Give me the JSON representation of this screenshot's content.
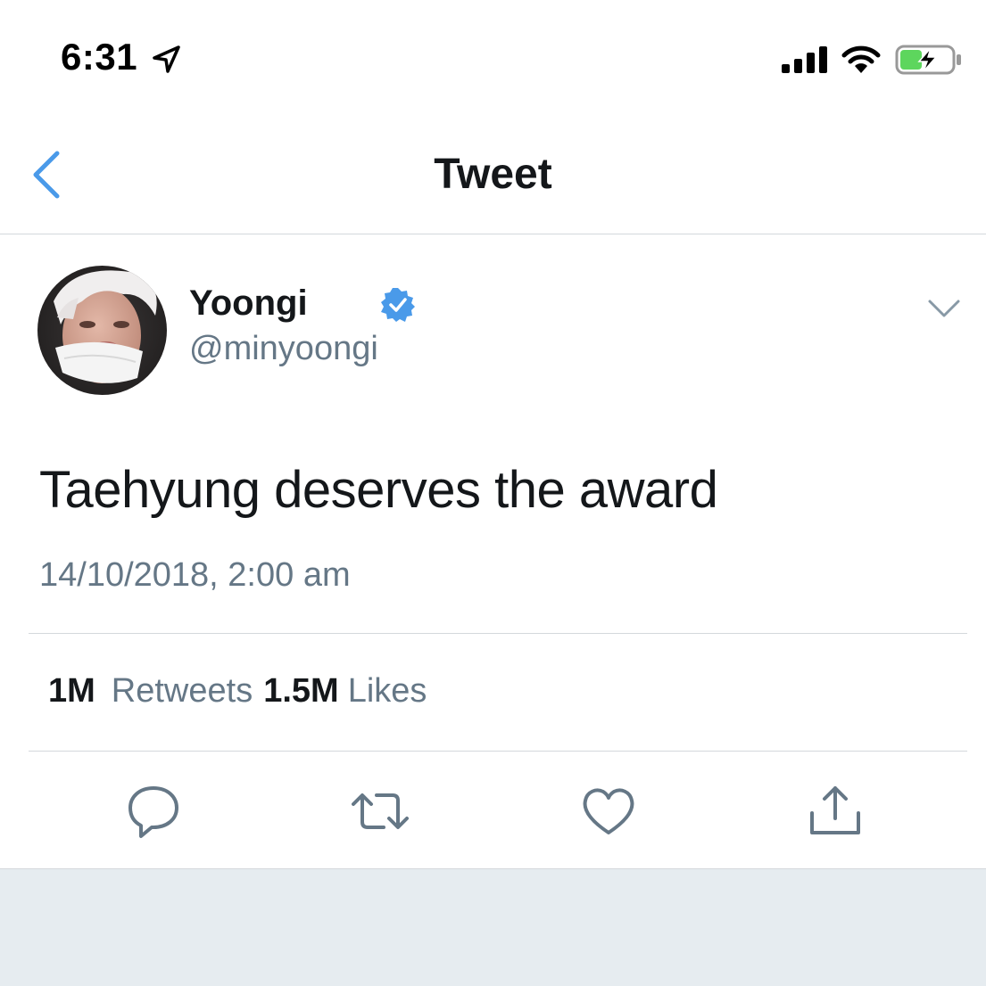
{
  "status_bar": {
    "time": "6:31"
  },
  "nav": {
    "title": "Tweet"
  },
  "tweet": {
    "display_name": "Yoongi",
    "handle": "@minyoongi",
    "verified": true,
    "text": "Taehyung deserves the award",
    "timestamp": "14/10/2018, 2:00 am",
    "retweets_count": "1M",
    "retweets_label": "Retweets",
    "likes_count": "1.5M",
    "likes_label": "Likes"
  },
  "icons": [
    "location-arrow-icon",
    "signal-icon",
    "wifi-icon",
    "battery-charging-icon",
    "back-chevron-icon",
    "verified-badge-icon",
    "chevron-down-icon",
    "reply-icon",
    "retweet-icon",
    "like-heart-icon",
    "share-icon"
  ],
  "colors": {
    "accent": "#4a9ae9",
    "text_primary": "#14171a",
    "text_secondary": "#657786",
    "battery_green": "#5dd65d",
    "divider": "#d4d8dc",
    "footer_gray": "#e6ecf0"
  }
}
